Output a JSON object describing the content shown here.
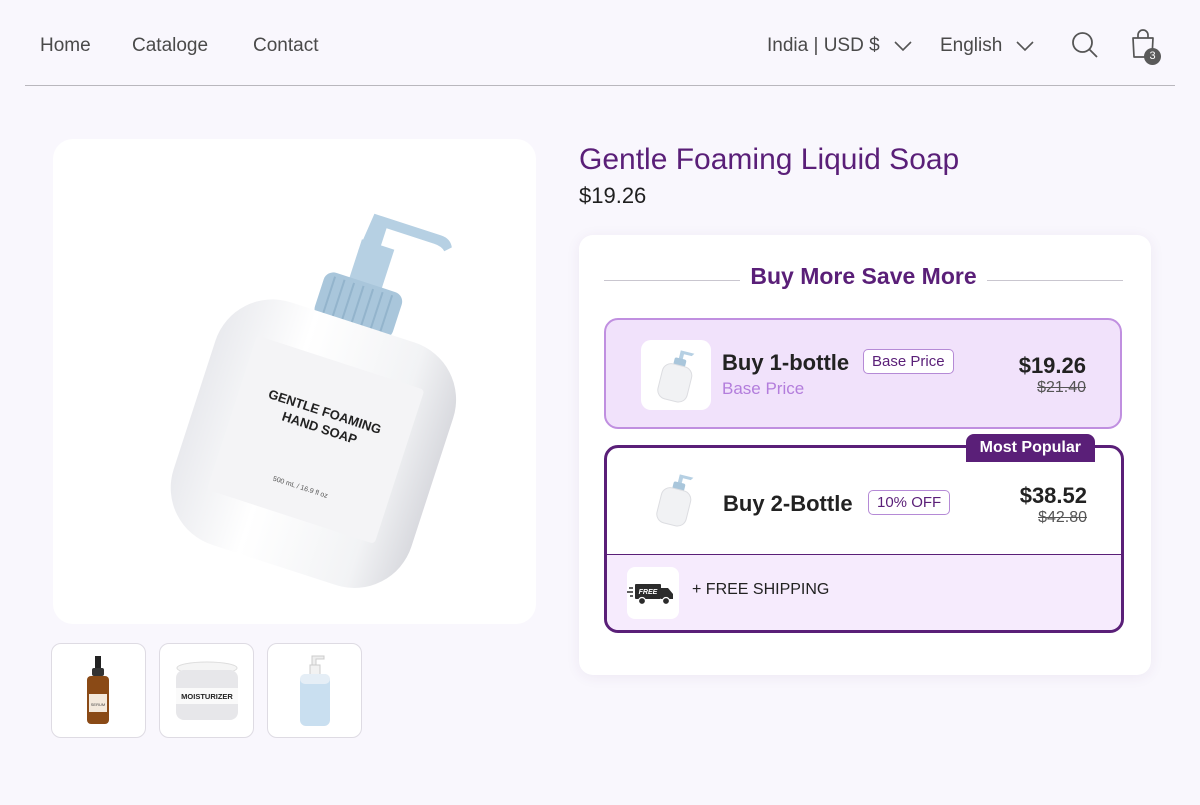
{
  "nav": {
    "links": [
      "Home",
      "Cataloge",
      "Contact"
    ],
    "region": "India | USD $",
    "language": "English",
    "cart_count": "3"
  },
  "product": {
    "title": "Gentle Foaming Liquid Soap",
    "price": "$19.26",
    "image_label_line1": "GENTLE FOAMING",
    "image_label_line2": "HAND SOAP",
    "image_label_volume": "500 mL / 16.9 fl oz",
    "thumbnails": [
      {
        "name": "serum",
        "text": "SERUM"
      },
      {
        "name": "moisturizer",
        "text": "MOISTURIZER"
      },
      {
        "name": "pump-bottle",
        "text": ""
      }
    ]
  },
  "bundle": {
    "heading": "Buy More Save More",
    "options": [
      {
        "title": "Buy 1-bottle",
        "badge": "Base Price",
        "subtitle": "Base Price",
        "price": "$19.26",
        "compare_price": "$21.40"
      },
      {
        "title": "Buy 2-Bottle",
        "badge": "10% OFF",
        "price": "$38.52",
        "compare_price": "$42.80",
        "tag": "Most Popular",
        "extra": "+ FREE SHIPPING",
        "extra_icon_text": "FREE"
      }
    ]
  },
  "colors": {
    "accent": "#5a1f78",
    "selected_bg": "#f1e2fb",
    "selected_border": "#c08fe0",
    "page_bg": "#f9f7fd"
  }
}
